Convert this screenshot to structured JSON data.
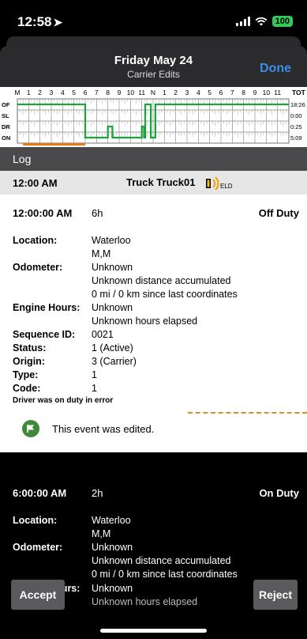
{
  "status": {
    "time": "12:58",
    "battery": "100"
  },
  "header": {
    "title": "Friday May 24",
    "subtitle": "Carrier Edits",
    "done_label": "Done"
  },
  "graph": {
    "hour_labels": [
      "M",
      "1",
      "2",
      "3",
      "4",
      "5",
      "6",
      "7",
      "8",
      "9",
      "10",
      "11",
      "N",
      "1",
      "2",
      "3",
      "4",
      "5",
      "6",
      "7",
      "8",
      "9",
      "10",
      "11"
    ],
    "row_labels": [
      "OF",
      "SL",
      "DR",
      "ON"
    ],
    "totals_header": "TOT",
    "totals": [
      "18:26",
      "0:00",
      "0:25",
      "5:09"
    ],
    "line_color": "#1aa33a",
    "edit_range_color": "#e07b1a"
  },
  "log": {
    "title": "Log"
  },
  "truck": {
    "time": "12:00 AM",
    "name": "Truck Truck01",
    "eld_label": "ELD"
  },
  "event1": {
    "time": "12:00:00 AM",
    "duration": "6h",
    "status": "Off Duty",
    "location_label": "Location:",
    "location": [
      "Waterloo",
      "M,M"
    ],
    "odometer_label": "Odometer:",
    "odometer": [
      "Unknown",
      "Unknown distance accumulated",
      "0 mi / 0 km since last coordinates"
    ],
    "engine_label": "Engine Hours:",
    "engine": [
      "Unknown",
      "Unknown hours elapsed"
    ],
    "sequence_label": "Sequence ID:",
    "sequence": "0021",
    "status_label": "Status:",
    "status_value": "1 (Active)",
    "origin_label": "Origin:",
    "origin": "3 (Carrier)",
    "type_label": "Type:",
    "type": "1",
    "code_label": "Code:",
    "code": "1",
    "note": "Driver was on duty in error",
    "edited_text": "This event was edited."
  },
  "event2": {
    "time": "6:00:00 AM",
    "duration": "2h",
    "status": "On Duty",
    "location_label": "Location:",
    "location": [
      "Waterloo",
      "M,M"
    ],
    "odometer_label": "Odometer:",
    "odometer": [
      "Unknown",
      "Unknown distance accumulated",
      "0 mi / 0 km since last coordinates"
    ],
    "engine_label": "Engine Hours:",
    "engine": [
      "Unknown",
      "Unknown hours elapsed"
    ]
  },
  "actions": {
    "accept": "Accept",
    "reject": "Reject"
  }
}
